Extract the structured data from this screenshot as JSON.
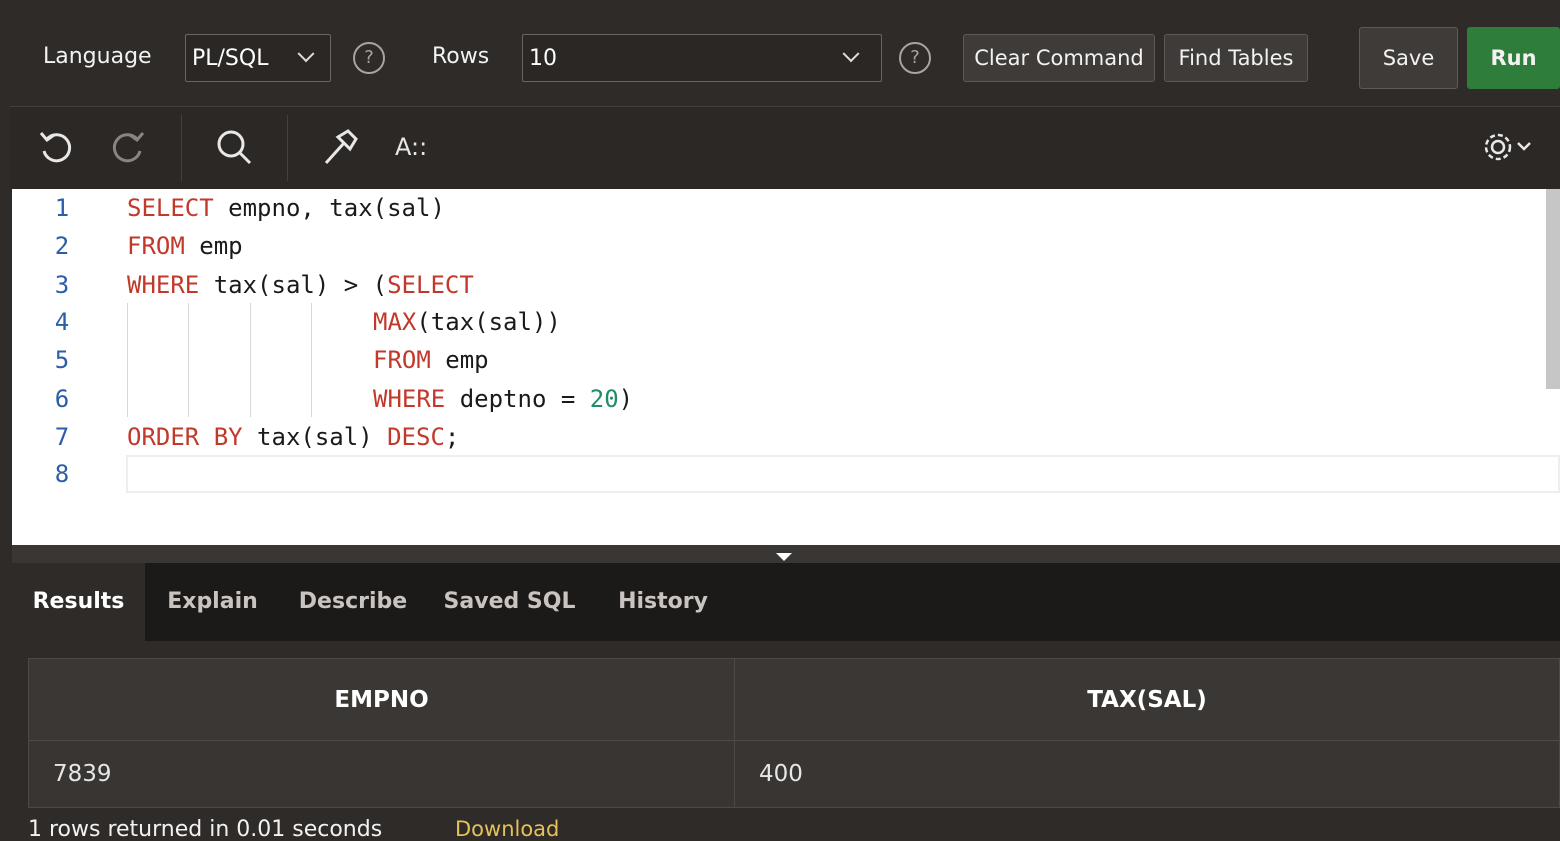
{
  "toolbar": {
    "language_label": "Language",
    "language_value": "PL/SQL",
    "rows_label": "Rows",
    "rows_value": "10",
    "help_glyph": "?",
    "clear_command": "Clear Command",
    "find_tables": "Find Tables",
    "save": "Save",
    "run": "Run"
  },
  "editor_toolbar": {
    "icons": [
      "undo-icon",
      "redo-icon",
      "search-icon",
      "hammer-icon",
      "format-icon",
      "gear-icon"
    ],
    "format_text": "A::"
  },
  "editor": {
    "line_numbers": [
      "1",
      "2",
      "3",
      "4",
      "5",
      "6",
      "7",
      "8"
    ],
    "lines": [
      {
        "kw1": "SELECT",
        "rest1": " empno, tax(sal)"
      },
      {
        "kw1": "FROM",
        "rest1": " emp"
      },
      {
        "kw1": "WHERE",
        "rest1": " tax(sal) > (",
        "kw2": "SELECT"
      },
      {
        "kw1": "MAX",
        "rest1": "(tax(sal))"
      },
      {
        "kw1": "FROM",
        "rest1": " emp"
      },
      {
        "kw1": "WHERE",
        "rest1": " deptno = ",
        "num": "20",
        "rest2": ")"
      },
      {
        "kw1": "ORDER BY",
        "rest1": " tax(sal) ",
        "kw2": "DESC",
        "rest2": ";"
      }
    ]
  },
  "tabs": [
    "Results",
    "Explain",
    "Describe",
    "Saved SQL",
    "History"
  ],
  "results": {
    "columns": [
      "EMPNO",
      "TAX(SAL)"
    ],
    "rows": [
      [
        "7839",
        "400"
      ]
    ],
    "status": "1 rows returned in 0.01 seconds",
    "download": "Download"
  },
  "colors": {
    "run_button": "#2e7d3a",
    "keyword": "#c0392b",
    "number": "#1f8c6b",
    "download_link": "#e5c158"
  }
}
